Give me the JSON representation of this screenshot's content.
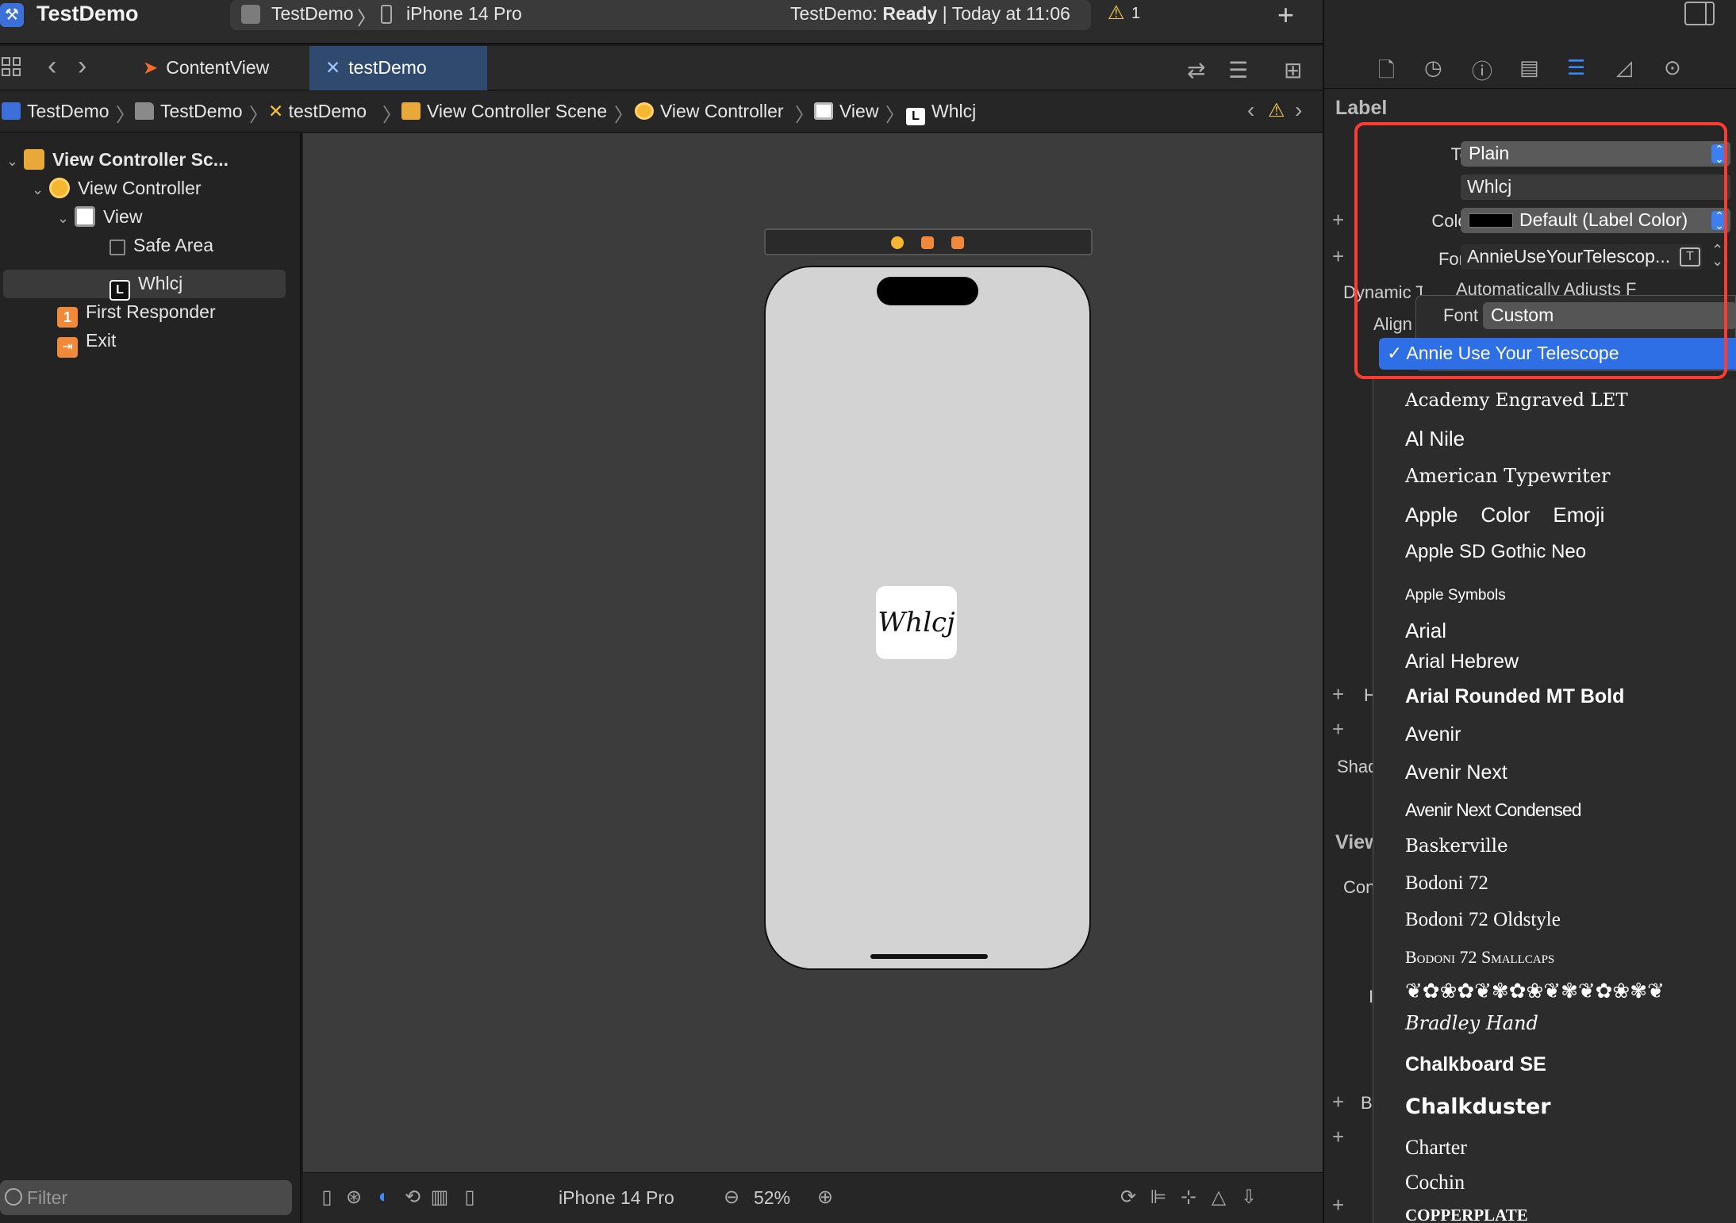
{
  "titlebar": {
    "app_title": "TestDemo",
    "scheme": "TestDemo",
    "device": "iPhone 14 Pro",
    "status_prefix": "TestDemo:",
    "status_state": "Ready",
    "status_suffix": "| Today at 11:06",
    "warning_count": "1"
  },
  "tabs": [
    {
      "label": "ContentView",
      "icon": "swift-icon"
    },
    {
      "label": "testDemo",
      "icon": "storyboard-icon"
    }
  ],
  "breadcrumb": [
    "TestDemo",
    "TestDemo",
    "testDemo",
    "View Controller Scene",
    "View Controller",
    "View",
    "Whlcj"
  ],
  "navigator": {
    "items": [
      "View Controller Sc...",
      "View Controller",
      "View",
      "Safe Area",
      "Whlcj",
      "First Responder",
      "Exit"
    ],
    "first_responder_badge": "1",
    "label_badge": "L",
    "filter_placeholder": "Filter"
  },
  "canvas": {
    "label_text": "Whlcj",
    "device": "iPhone 14 Pro",
    "zoom": "52%"
  },
  "inspector": {
    "section": "Label",
    "text_label": "Text",
    "text_type": "Plain",
    "text_value": "Whlcj",
    "color_label": "Color",
    "color_value": "Default (Label Color)",
    "font_label": "Font",
    "font_value": "AnnieUseYourTelescop...",
    "dynamic_type_label": "Dynamic Ty",
    "dynamic_type_value": "Automatically Adjusts F",
    "align_label": "Align",
    "shadow_label": "Shad",
    "view_section": "View",
    "con_label": "Con",
    "h_label": "H",
    "b_label": "B",
    "i_label": "I"
  },
  "font_popover": {
    "font_label": "Font",
    "font_type": "Custom",
    "selected": "Annie Use Your Telescope",
    "fonts": [
      "Academy Engraved LET",
      "Al Nile",
      "American Typewriter",
      "Apple    Color    Emoji",
      "Apple SD Gothic Neo",
      "Apple Symbols",
      "Arial",
      "Arial Hebrew",
      "Arial Rounded MT Bold",
      "Avenir",
      "Avenir Next",
      "Avenir Next Condensed",
      "Baskerville",
      "Bodoni 72",
      "Bodoni 72 Oldstyle",
      "Bodoni 72 Smallcaps",
      "❦✿❀✿❦✾✿❀❦✾❦✿❀✾❦",
      "Bradley Hand",
      "Chalkboard SE",
      "Chalkduster",
      "Charter",
      "Cochin",
      "Copperplate"
    ]
  },
  "colors": {
    "accent": "#2f6fe6",
    "highlight": "#ff3b30",
    "tab_active": "#2f4a6e"
  }
}
